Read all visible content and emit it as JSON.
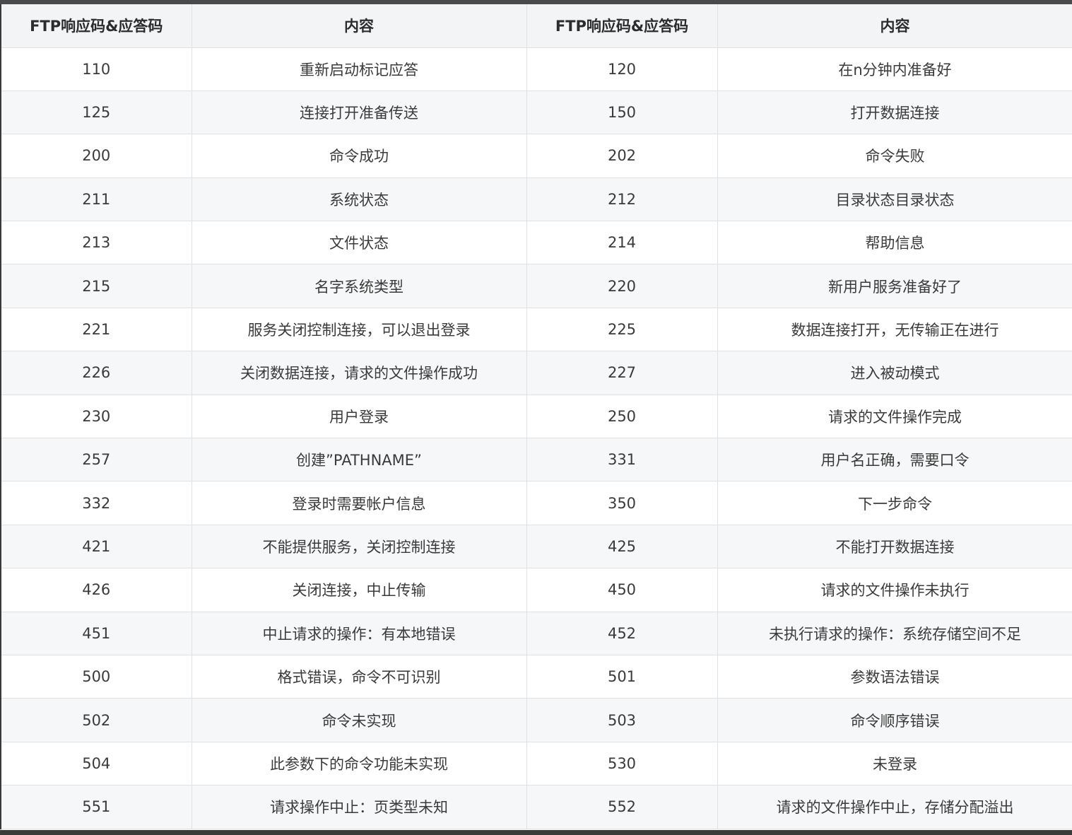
{
  "table": {
    "headers": [
      "FTP响应码&应答码",
      "内容",
      "FTP响应码&应答码",
      "内容"
    ],
    "rows": [
      [
        "110",
        "重新启动标记应答",
        "120",
        "在n分钟内准备好"
      ],
      [
        "125",
        "连接打开准备传送",
        "150",
        "打开数据连接"
      ],
      [
        "200",
        "命令成功",
        "202",
        "命令失败"
      ],
      [
        "211",
        "系统状态",
        "212",
        "目录状态目录状态"
      ],
      [
        "213",
        "文件状态",
        "214",
        "帮助信息"
      ],
      [
        "215",
        "名字系统类型",
        "220",
        "新用户服务准备好了"
      ],
      [
        "221",
        "服务关闭控制连接，可以退出登录",
        "225",
        "数据连接打开，无传输正在进行"
      ],
      [
        "226",
        "关闭数据连接，请求的文件操作成功",
        "227",
        "进入被动模式"
      ],
      [
        "230",
        "用户登录",
        "250",
        "请求的文件操作完成"
      ],
      [
        "257",
        "创建”PATHNAME”",
        "331",
        "用户名正确，需要口令"
      ],
      [
        "332",
        "登录时需要帐户信息",
        "350",
        "下一步命令"
      ],
      [
        "421",
        "不能提供服务，关闭控制连接",
        "425",
        "不能打开数据连接"
      ],
      [
        "426",
        "关闭连接，中止传输",
        "450",
        "请求的文件操作未执行"
      ],
      [
        "451",
        "中止请求的操作：有本地错误",
        "452",
        "未执行请求的操作：系统存储空间不足"
      ],
      [
        "500",
        "格式错误，命令不可识别",
        "501",
        "参数语法错误"
      ],
      [
        "502",
        "命令未实现",
        "503",
        "命令顺序错误"
      ],
      [
        "504",
        "此参数下的命令功能未实现",
        "530",
        "未登录"
      ],
      [
        "551",
        "请求操作中止：页类型未知",
        "552",
        "请求的文件操作中止，存储分配溢出"
      ]
    ]
  }
}
